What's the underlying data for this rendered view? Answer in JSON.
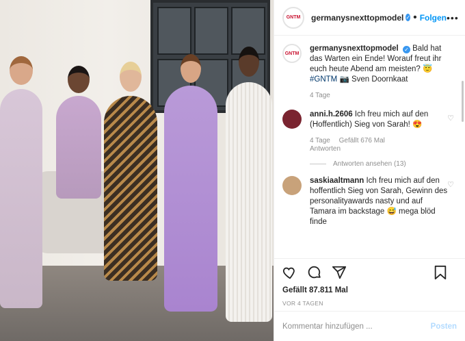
{
  "post": {
    "username": "germanysnexttopmodel",
    "avatar_text": "GNTM",
    "follow_label": "Folgen",
    "separator": "•",
    "more_icon": "more-icon"
  },
  "caption": {
    "username": "germanysnexttopmodel",
    "text": "Bald hat das Warten ein Ende! Worauf freut ihr euch heute Abend am meisten? 😇",
    "hashtag": "#GNTM",
    "camera": "📷",
    "credit": "Sven Doornkaat",
    "time": "4 Tage"
  },
  "comments": [
    {
      "username": "anni.h.2606",
      "text": "Ich freu mich auf den (Hoffentlich) Sieg von Sarah! 😍",
      "time": "4 Tage",
      "likes": "Gefällt 676 Mal",
      "reply": "Antworten",
      "view_replies": "Antworten ansehen (13)",
      "avatar_color": "#7a2430"
    },
    {
      "username": "saskiaaltmann",
      "text": "Ich freu mich auf den hoffentlich Sieg von Sarah, Gewinn des personalityawards nasty und auf Tamara im backstage 😅 mega blöd finde",
      "avatar_color": "#c8a27a"
    }
  ],
  "actions": {
    "likes": "Gefällt 87.811 Mal",
    "date": "VOR 4 TAGEN"
  },
  "add_comment": {
    "placeholder": "Kommentar hinzufügen ...",
    "post_label": "Posten"
  },
  "colors": {
    "accent": "#0095f6",
    "muted": "#8e8e8e",
    "text": "#262626"
  }
}
